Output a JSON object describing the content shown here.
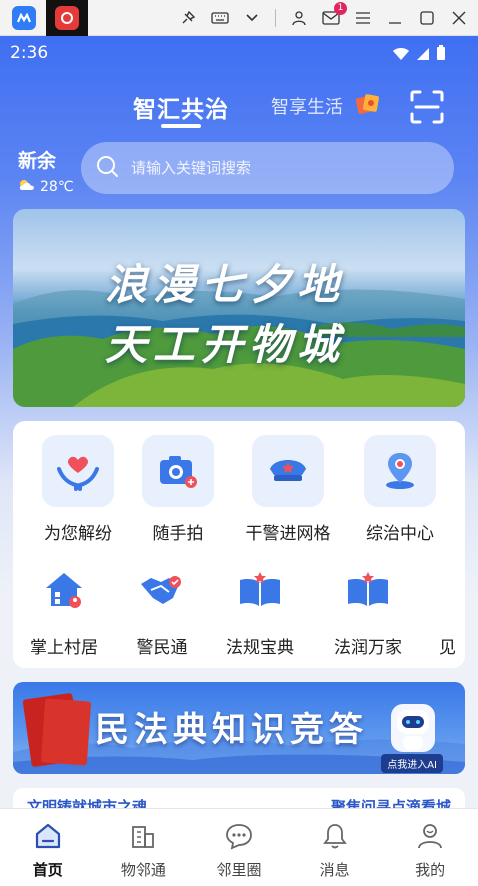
{
  "titlebar": {
    "mail_badge": "1"
  },
  "status_bar": {
    "time": "2:36"
  },
  "header": {
    "tab_active": "智汇共治",
    "tab_other": "智享生活"
  },
  "location": {
    "city": "新余",
    "temperature": "28℃"
  },
  "search": {
    "placeholder": "请输入关键词搜索"
  },
  "banner": {
    "line1": "浪漫七夕地",
    "line2": "天工开物城"
  },
  "services_row1": [
    {
      "label": "为您解纷",
      "icon": "heart-hands-icon"
    },
    {
      "label": "随手拍",
      "icon": "camera-icon"
    },
    {
      "label": "干警进网格",
      "icon": "police-cap-icon"
    },
    {
      "label": "综治中心",
      "icon": "location-pin-icon"
    }
  ],
  "services_row2": [
    {
      "label": "掌上村居",
      "icon": "house-icon"
    },
    {
      "label": "警民通",
      "icon": "handshake-icon"
    },
    {
      "label": "法规宝典",
      "icon": "law-book-icon"
    },
    {
      "label": "法润万家",
      "icon": "law-book-icon"
    },
    {
      "label": "见"
    }
  ],
  "promo": {
    "title": "民法典知识竞答",
    "button": "点我进入AI"
  },
  "next_card": {
    "left": "文明铸就城市之魂",
    "right": "聚焦问寻点滴看城"
  },
  "bottom_nav": [
    {
      "label": "首页",
      "icon": "home-icon"
    },
    {
      "label": "物邻通",
      "icon": "building-icon"
    },
    {
      "label": "邻里圈",
      "icon": "chat-icon"
    },
    {
      "label": "消息",
      "icon": "bell-icon"
    },
    {
      "label": "我的",
      "icon": "user-icon"
    }
  ],
  "colors": {
    "accent": "#3f6ff2",
    "icon_blue": "#3a78e8",
    "icon_red": "#f0505a"
  }
}
